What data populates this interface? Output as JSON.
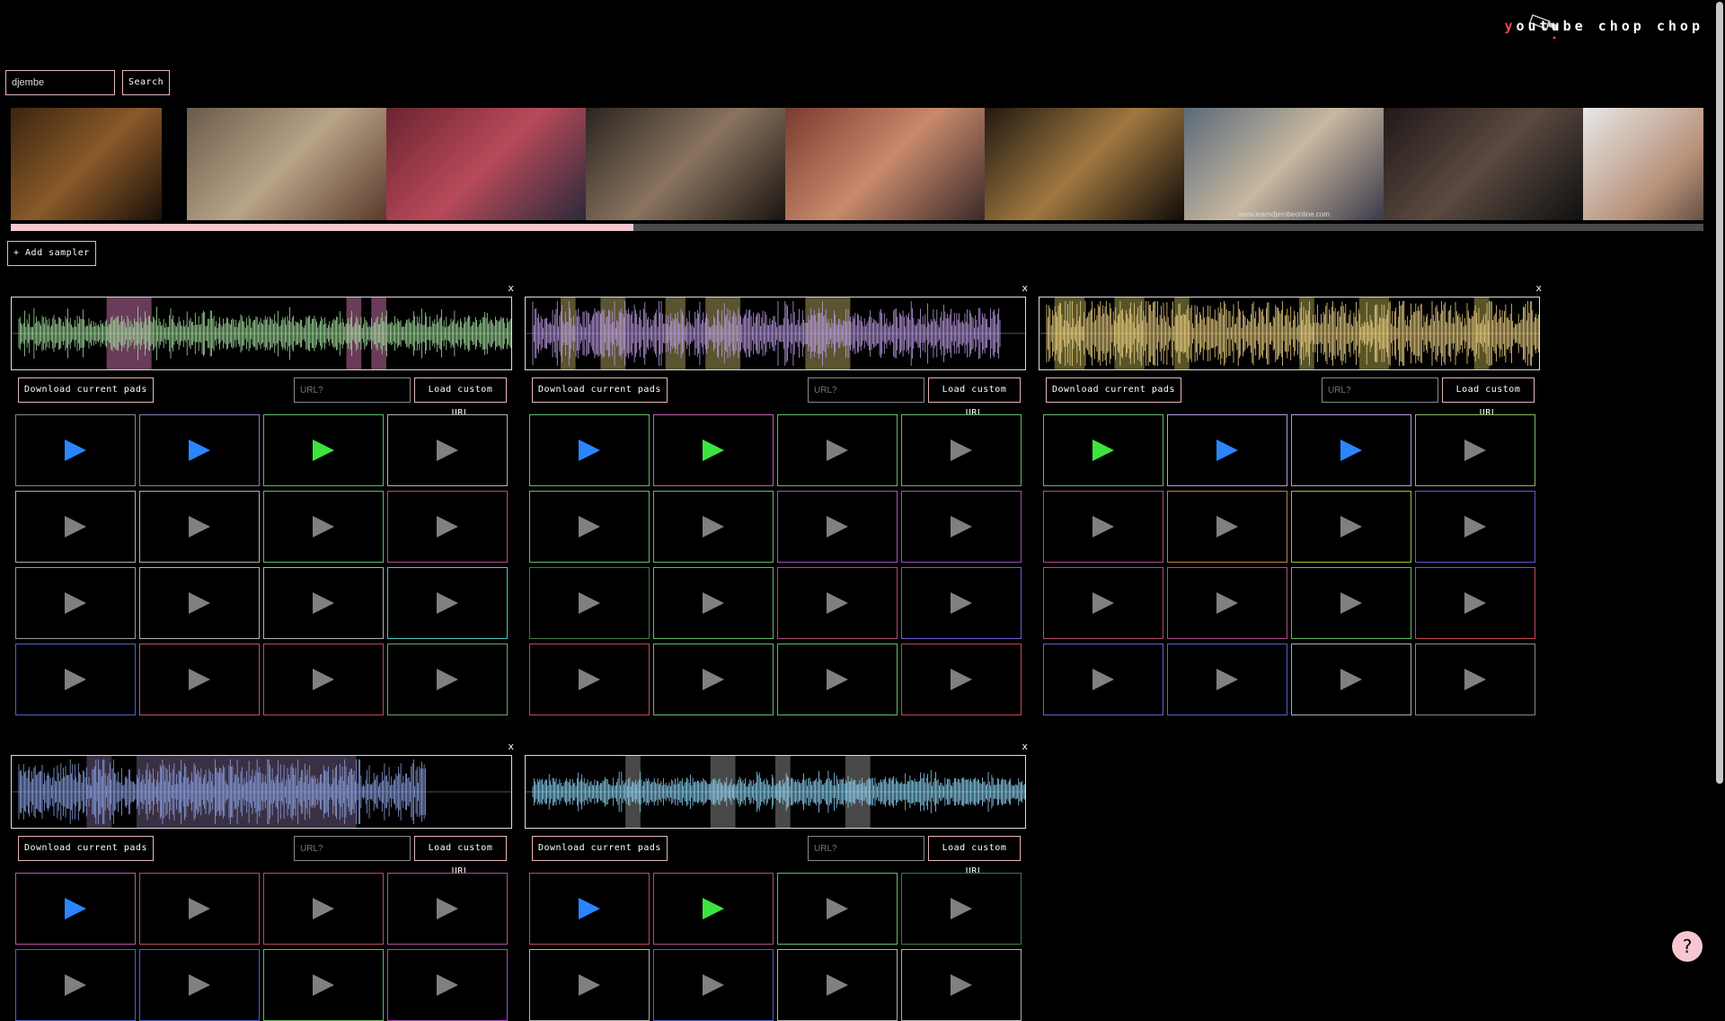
{
  "header": {
    "title_first": "y",
    "title_rest": "outube chop chop"
  },
  "search": {
    "value": "djembe",
    "button_label": "Search"
  },
  "thumbnails": [
    {
      "w": 168,
      "colors": [
        "#3a2410",
        "#8a5a2a",
        "#1a1008"
      ],
      "caption": ""
    },
    {
      "w": 28,
      "colors": [
        "#000",
        "#000",
        "#000"
      ],
      "caption": ""
    },
    {
      "w": 222,
      "colors": [
        "#6b5a4a",
        "#b8a488",
        "#5a3a2a"
      ],
      "caption": ""
    },
    {
      "w": 222,
      "colors": [
        "#6a2430",
        "#b84a5a",
        "#2a2a3a"
      ],
      "caption": ""
    },
    {
      "w": 222,
      "colors": [
        "#2a2420",
        "#8a7460",
        "#1a1410"
      ],
      "caption": ""
    },
    {
      "w": 222,
      "colors": [
        "#7a3a30",
        "#c88a6a",
        "#3a2a2a"
      ],
      "caption": ""
    },
    {
      "w": 222,
      "colors": [
        "#201810",
        "#a07840",
        "#100c08"
      ],
      "caption": ""
    },
    {
      "w": 222,
      "colors": [
        "#5a6a7a",
        "#c8b8a0",
        "#3a3a4a"
      ],
      "caption": "www.learndjembeonline.com"
    },
    {
      "w": 222,
      "colors": [
        "#201818",
        "#5a4a40",
        "#101010"
      ],
      "caption": ""
    },
    {
      "w": 222,
      "colors": [
        "#e8e8e8",
        "#b89078",
        "#101010"
      ],
      "caption": ""
    }
  ],
  "progress": {
    "fraction": 0.368
  },
  "add_sampler_label": "+ Add sampler",
  "sampler_common": {
    "download_label": "Download current pads",
    "url_placeholder": "URL?",
    "load_label": "Load custom URL",
    "close_label": "x"
  },
  "samplers": [
    {
      "color": "#9fd89a",
      "highlight": "#6a3c5a",
      "wave_end": 1.0,
      "noise": 0.35,
      "regions": [
        [
          0.19,
          0.28
        ],
        [
          0.67,
          0.7
        ],
        [
          0.72,
          0.75
        ]
      ],
      "pads": [
        {
          "c": "#888888",
          "p": "#2a86ff"
        },
        {
          "c": "#8a7fb8",
          "p": "#2a86ff"
        },
        {
          "c": "#63b96a",
          "p": "#3ee43e"
        },
        {
          "c": "#b0b0b0",
          "p": "#808080"
        },
        {
          "c": "#b0b0b0",
          "p": "#808080"
        },
        {
          "c": "#b0b0b0",
          "p": "#808080"
        },
        {
          "c": "#63b96a",
          "p": "#808080"
        },
        {
          "c": "#b04a8a",
          "p": "#808080"
        },
        {
          "c": "#9a9a9a",
          "p": "#808080"
        },
        {
          "c": "#b0b0b0",
          "p": "#808080"
        },
        {
          "c": "#b0b0b0",
          "p": "#808080"
        },
        {
          "c": "#4ec4c4",
          "p": "#808080"
        },
        {
          "c": "#5060d0",
          "p": "#808080"
        },
        {
          "c": "#c05068",
          "p": "#808080"
        },
        {
          "c": "#c04858",
          "p": "#808080"
        },
        {
          "c": "#66a866",
          "p": "#808080"
        }
      ]
    },
    {
      "color": "#b89ae0",
      "highlight": "#5a5430",
      "wave_end": 0.95,
      "noise": 0.55,
      "regions": [
        [
          0.07,
          0.1
        ],
        [
          0.15,
          0.2
        ],
        [
          0.28,
          0.32
        ],
        [
          0.36,
          0.43
        ],
        [
          0.56,
          0.65
        ]
      ],
      "pads": [
        {
          "c": "#63b96a",
          "p": "#2a86ff"
        },
        {
          "c": "#c060b0",
          "p": "#3ee43e"
        },
        {
          "c": "#63b96a",
          "p": "#808080"
        },
        {
          "c": "#63b96a",
          "p": "#808080"
        },
        {
          "c": "#63b96a",
          "p": "#808080"
        },
        {
          "c": "#63b96a",
          "p": "#808080"
        },
        {
          "c": "#a050c0",
          "p": "#808080"
        },
        {
          "c": "#a050c0",
          "p": "#808080"
        },
        {
          "c": "#3e7a48",
          "p": "#808080"
        },
        {
          "c": "#63b96a",
          "p": "#808080"
        },
        {
          "c": "#b04a7a",
          "p": "#808080"
        },
        {
          "c": "#6a60d0",
          "p": "#808080"
        },
        {
          "c": "#c04858",
          "p": "#808080"
        },
        {
          "c": "#63b96a",
          "p": "#808080"
        },
        {
          "c": "#63b96a",
          "p": "#808080"
        },
        {
          "c": "#c04858",
          "p": "#808080"
        }
      ]
    },
    {
      "color": "#e8cc80",
      "highlight": "#585428",
      "wave_end": 1.0,
      "noise": 0.75,
      "regions": [
        [
          0.03,
          0.09
        ],
        [
          0.15,
          0.21
        ],
        [
          0.27,
          0.3
        ],
        [
          0.52,
          0.55
        ],
        [
          0.64,
          0.7
        ],
        [
          0.87,
          0.9
        ]
      ],
      "pads": [
        {
          "c": "#63b96a",
          "p": "#3ee43e"
        },
        {
          "c": "#b89ae0",
          "p": "#2a86ff"
        },
        {
          "c": "#b89ae0",
          "p": "#2a86ff"
        },
        {
          "c": "#8ab868",
          "p": "#808080"
        },
        {
          "c": "#b04a8a",
          "p": "#808080"
        },
        {
          "c": "#c08040",
          "p": "#808080"
        },
        {
          "c": "#9ac040",
          "p": "#808080"
        },
        {
          "c": "#7050d0",
          "p": "#808080"
        },
        {
          "c": "#b04a7a",
          "p": "#808080"
        },
        {
          "c": "#b04a8a",
          "p": "#808080"
        },
        {
          "c": "#63b96a",
          "p": "#808080"
        },
        {
          "c": "#c04858",
          "p": "#808080"
        },
        {
          "c": "#6a60d0",
          "p": "#808080"
        },
        {
          "c": "#5060d0",
          "p": "#808080"
        },
        {
          "c": "#b0b0b0",
          "p": "#808080"
        },
        {
          "c": "#888888",
          "p": "#808080"
        }
      ]
    },
    {
      "color": "#8aa0e0",
      "highlight": "#3a3044",
      "wave_end": 0.83,
      "noise": 0.65,
      "regions": [
        [
          0.15,
          0.2
        ],
        [
          0.25,
          0.69
        ]
      ],
      "pads": [
        {
          "c": "#c050b0",
          "p": "#2a86ff"
        },
        {
          "c": "#c04858",
          "p": "#808080"
        },
        {
          "c": "#c04858",
          "p": "#808080"
        },
        {
          "c": "#b050a0",
          "p": "#808080"
        },
        {
          "c": "#5060d0",
          "p": "#808080"
        },
        {
          "c": "#5060d0",
          "p": "#808080"
        },
        {
          "c": "#63b96a",
          "p": "#808080"
        },
        {
          "c": "#a050c0",
          "p": "#808080"
        }
      ]
    },
    {
      "color": "#8ad0f0",
      "highlight": "#484848",
      "wave_end": 1.0,
      "noise": 0.25,
      "regions": [
        [
          0.2,
          0.23
        ],
        [
          0.37,
          0.42
        ],
        [
          0.5,
          0.53
        ],
        [
          0.64,
          0.69
        ]
      ],
      "pads": [
        {
          "c": "#c04858",
          "p": "#2a86ff"
        },
        {
          "c": "#b04a8a",
          "p": "#3ee43e"
        },
        {
          "c": "#63b96a",
          "p": "#808080"
        },
        {
          "c": "#3e7a48",
          "p": "#808080"
        },
        {
          "c": "#b0b0b0",
          "p": "#808080"
        },
        {
          "c": "#5060d0",
          "p": "#808080"
        },
        {
          "c": "#b0b0b0",
          "p": "#808080"
        },
        {
          "c": "#b0b0b0",
          "p": "#808080"
        }
      ]
    }
  ],
  "help_label": "?"
}
